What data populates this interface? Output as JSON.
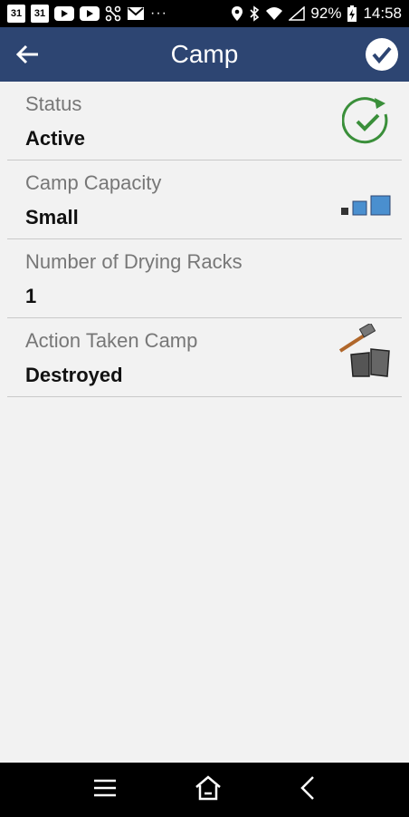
{
  "status_bar": {
    "cal1": "31",
    "cal2": "31",
    "dots": "···",
    "battery": "92%",
    "time": "14:58"
  },
  "app_bar": {
    "title": "Camp"
  },
  "fields": [
    {
      "label": "Status",
      "value": "Active",
      "icon": "active-check-icon"
    },
    {
      "label": "Camp Capacity",
      "value": "Small",
      "icon": "capacity-small-icon"
    },
    {
      "label": "Number of Drying Racks",
      "value": "1"
    },
    {
      "label": "Action Taken Camp",
      "value": "Destroyed",
      "icon": "destroyed-hammer-icon"
    }
  ],
  "colors": {
    "app_bar": "#2d4572",
    "accent_green": "#3a8f3a",
    "capacity_blue": "#4a8fcf"
  }
}
